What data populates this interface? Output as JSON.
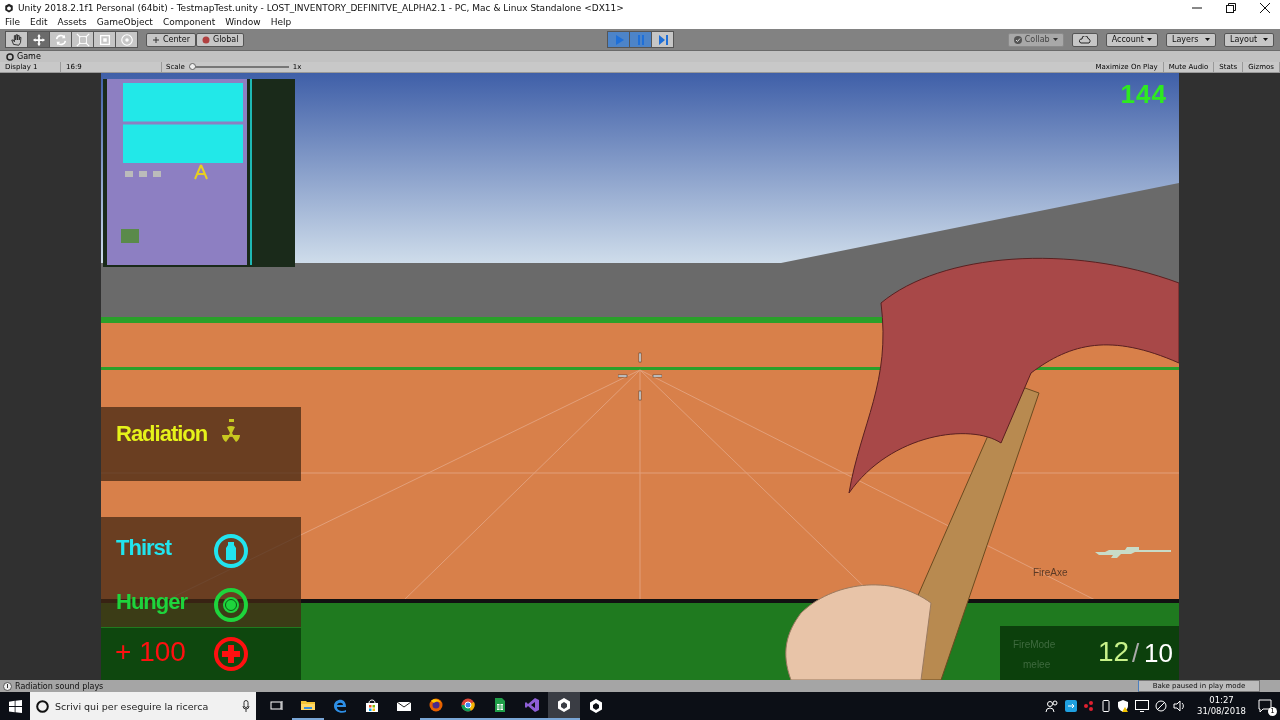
{
  "window": {
    "title": "Unity 2018.2.1f1 Personal (64bit) - TestmapTest.unity - LOST_INVENTORY_DEFINITVE_ALPHA2.1 - PC, Mac & Linux Standalone <DX11>"
  },
  "menu": [
    "File",
    "Edit",
    "Assets",
    "GameObject",
    "Component",
    "Window",
    "Help"
  ],
  "toolbar": {
    "tools": [
      {
        "kind": "hand",
        "selected": false
      },
      {
        "kind": "move",
        "selected": true
      },
      {
        "kind": "rotate",
        "selected": false
      },
      {
        "kind": "scale",
        "selected": false
      },
      {
        "kind": "rect",
        "selected": false
      },
      {
        "kind": "transform",
        "selected": false
      }
    ],
    "pivot": [
      {
        "kind": "pivot",
        "label": "Center"
      },
      {
        "kind": "globe",
        "label": "Global"
      }
    ],
    "play": [
      {
        "kind": "play",
        "on": true
      },
      {
        "kind": "pause",
        "on": true
      },
      {
        "kind": "step",
        "on": false
      }
    ],
    "collab": {
      "label": "Collab",
      "disabled": true
    },
    "dropdowns": [
      "Account",
      "Layers",
      "Layout"
    ]
  },
  "game_tab": {
    "label": "Game"
  },
  "game_toolbar": {
    "display": "Display 1",
    "aspect": "16:9",
    "scale_label": "Scale",
    "scale": {
      "level": 0.0,
      "reading": "1x"
    },
    "toggles": [
      "Maximize On Play",
      "Mute Audio",
      "Stats",
      "Gizmos"
    ]
  },
  "hud": {
    "counter": "144",
    "radiation": "Radiation",
    "stats": [
      {
        "kind": "thirst",
        "label": "Thirst",
        "color": "#22e4ee"
      },
      {
        "kind": "hunger",
        "label": "Hunger",
        "color": "#1ed43c"
      }
    ],
    "health": "+ 100",
    "weapon": "FireAxe",
    "fire_mode": "FireMode",
    "fire_mode_value": "melee",
    "ammo": "12",
    "ammo_separator": "/",
    "ammo_max": "10"
  },
  "status_bar": {
    "message": "Radiation sound plays",
    "bake": "Bake paused in play mode"
  },
  "taskbar": {
    "search": {
      "placeholder": "Scrivi qui per eseguire la ricerca"
    },
    "apps": [
      {
        "kind": "taskview",
        "running": false,
        "active": false
      },
      {
        "kind": "folder",
        "running": true,
        "active": false
      },
      {
        "kind": "edge",
        "running": false,
        "active": false
      },
      {
        "kind": "store",
        "running": false,
        "active": false
      },
      {
        "kind": "mail",
        "running": false,
        "active": false
      },
      {
        "kind": "firefox",
        "running": true,
        "active": false
      },
      {
        "kind": "chrome",
        "running": true,
        "active": false
      },
      {
        "kind": "sheet",
        "running": true,
        "active": false
      },
      {
        "kind": "studio",
        "running": true,
        "active": false
      },
      {
        "kind": "unity",
        "running": true,
        "active": true
      },
      {
        "kind": "unity",
        "running": false,
        "active": false
      }
    ],
    "time": "01:27",
    "date": "31/08/2018",
    "notifications": "1"
  }
}
